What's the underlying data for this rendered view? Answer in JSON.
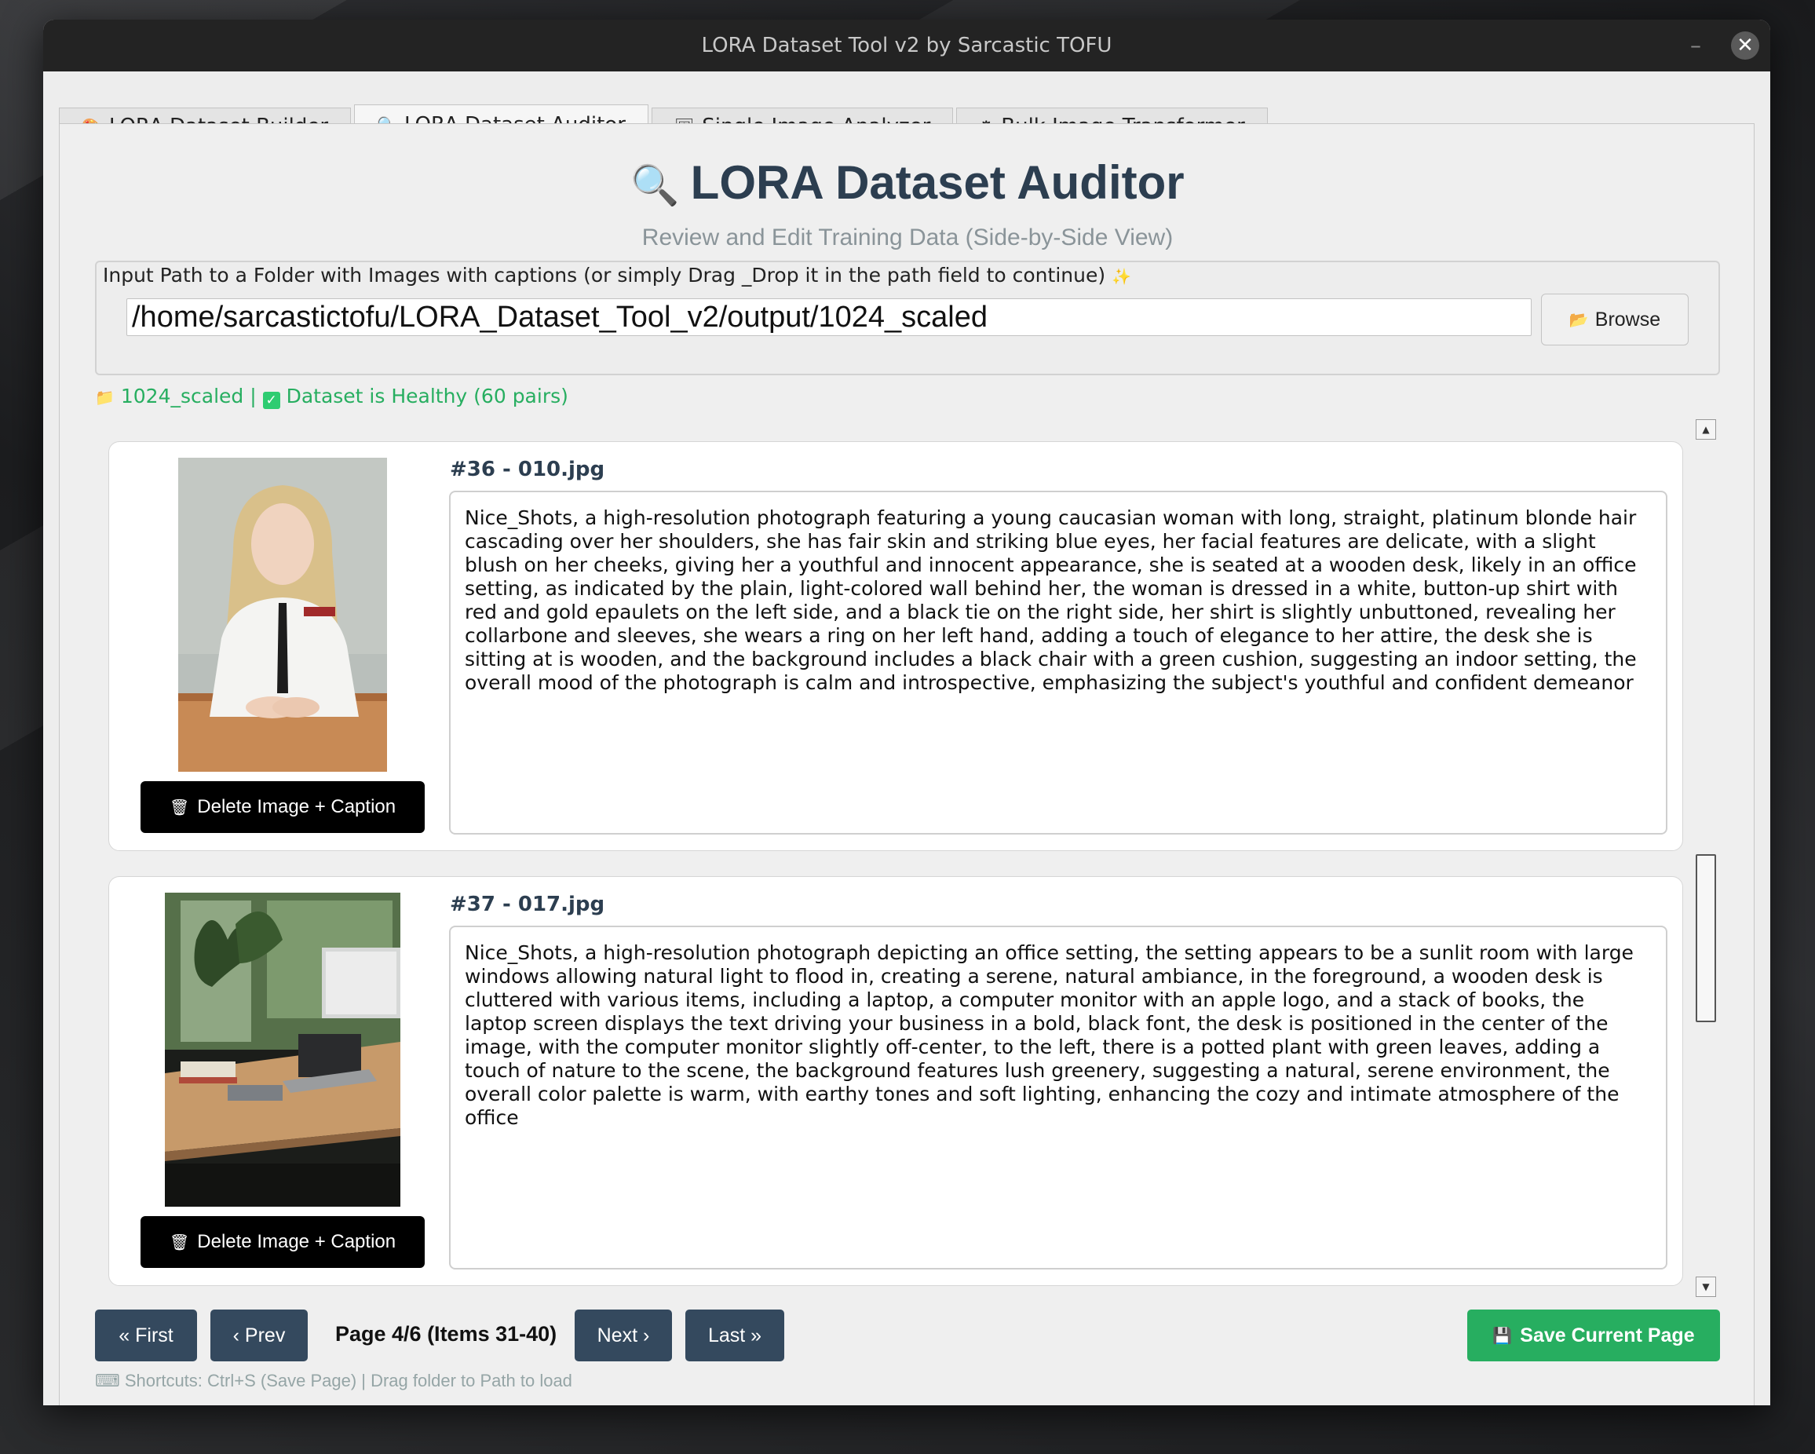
{
  "window": {
    "title": "LORA Dataset Tool v2 by Sarcastic TOFU",
    "minimize_glyph": "–",
    "close_glyph": "✕"
  },
  "tabs": [
    {
      "label": "LORA Dataset Builder",
      "icon": "palette-icon",
      "glyph": "🎨"
    },
    {
      "label": "LORA Dataset Auditor",
      "icon": "magnifier-icon",
      "glyph": "🔍",
      "active": true
    },
    {
      "label": "Single Image Analyzer",
      "icon": "picture-icon",
      "glyph": "🖼"
    },
    {
      "label": "Bulk Image Transformer",
      "icon": "gear-icon",
      "glyph": "⚙"
    }
  ],
  "header": {
    "icon": "magnifier-icon",
    "icon_glyph": "🔍",
    "title": "LORA Dataset Auditor",
    "subtitle": "Review and Edit Training Data (Side-by-Side View)"
  },
  "input": {
    "label": "Input Path to a Folder with Images with captions (or simply Drag _Drop it in the path field to continue)",
    "label_icon_glyph": "✨",
    "value": "/home/sarcastictofu/LORA_Dataset_Tool_v2/output/1024_scaled",
    "browse_label": "Browse",
    "browse_icon_glyph": "📂"
  },
  "status": {
    "folder_icon_glyph": "📁",
    "folder": "1024_scaled",
    "separator": "|",
    "check_glyph": "✓",
    "message": "Dataset is Healthy (60 pairs)"
  },
  "items": [
    {
      "title": "#36 - 010.jpg",
      "caption": "Nice_Shots, a high-resolution photograph featuring a young caucasian woman with long, straight, platinum blonde hair cascading over her shoulders, she has fair skin and striking blue eyes, her facial features are delicate, with a slight blush on her cheeks, giving her a youthful and innocent appearance, she is seated at a wooden desk, likely in an office setting, as indicated by the plain, light-colored wall behind her, the woman is dressed in a white, button-up shirt with red and gold epaulets on the left side, and a black tie on the right side, her shirt is slightly unbuttoned, revealing her collarbone and sleeves, she wears a ring on her left hand, adding a touch of elegance to her attire, the desk she is sitting at is wooden, and the background includes a black chair with a green cushion, suggesting an indoor setting, the overall mood of the photograph is calm and introspective, emphasizing the subject's youthful and confident demeanor",
      "delete_label": "Delete Image + Caption",
      "delete_icon_glyph": "🗑"
    },
    {
      "title": "#37 - 017.jpg",
      "caption": "Nice_Shots, a high-resolution photograph depicting an office setting, the setting appears to be a sunlit room with large windows allowing natural light to flood in, creating a serene, natural ambiance, in the foreground, a wooden desk is cluttered with various items, including a laptop, a computer monitor with an apple logo, and a stack of books, the laptop screen displays the text driving your business in a bold, black font, the desk is positioned in the center of the image, with the computer monitor slightly off-center, to the left, there is a potted plant with green leaves, adding a touch of nature to the scene, the background features lush greenery, suggesting a natural, serene environment, the overall color palette is warm, with earthy tones and soft lighting, enhancing the cozy and intimate atmosphere of the office",
      "delete_label": "Delete Image + Caption",
      "delete_icon_glyph": "🗑"
    }
  ],
  "pagination": {
    "first_label": "« First",
    "prev_label": "‹ Prev",
    "page_label": "Page 4/6 (Items 31-40)",
    "next_label": "Next ›",
    "last_label": "Last »"
  },
  "save": {
    "label": "Save Current Page",
    "icon_glyph": "💾"
  },
  "footer": {
    "shortcuts": "⌨ Shortcuts: Ctrl+S (Save Page) | Drag folder to Path to load"
  },
  "colors": {
    "accent_dark": "#34495e",
    "success": "#27ae60",
    "title_text": "#2c3e50"
  }
}
